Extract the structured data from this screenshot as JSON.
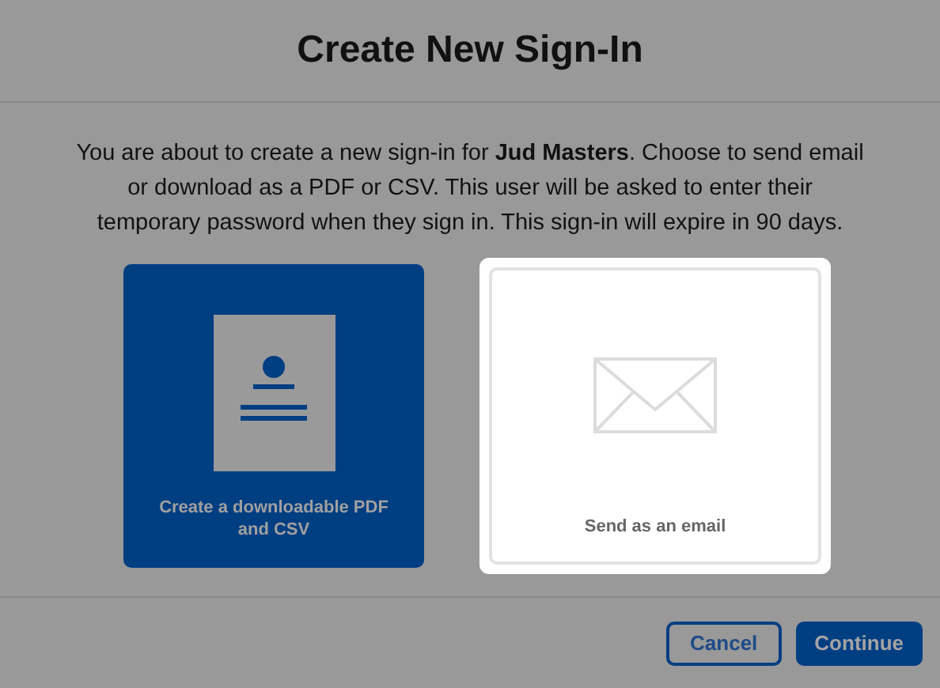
{
  "dialog": {
    "title": "Create New Sign-In",
    "message": "You are about to create a new sign-in for **Jud Masters**. Choose to send email or download as a PDF or CSV. This user will be asked to enter their temporary password when they sign in. This sign-in will expire in 90 days."
  },
  "options": [
    {
      "kind": "download",
      "label": "Create a downloadable PDF and CSV",
      "highlighted": false
    },
    {
      "kind": "email",
      "label": "Send as an email",
      "highlighted": true
    }
  ],
  "buttons": [
    {
      "kind": "secondary",
      "label": "Cancel"
    },
    {
      "kind": "primary",
      "label": "Continue"
    }
  ]
}
